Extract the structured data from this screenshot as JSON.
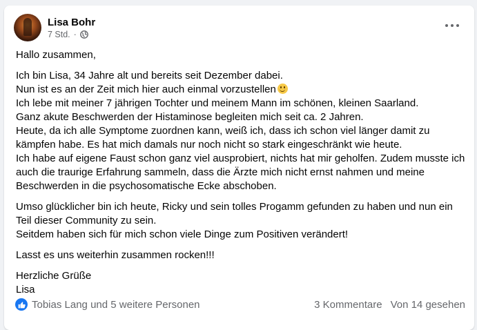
{
  "post": {
    "author": "Lisa Bohr",
    "time": "7 Std.",
    "separator": "·",
    "body": [
      [
        "Hallo zusammen,"
      ],
      [
        "Ich bin Lisa, 34 Jahre alt und bereits seit Dezember dabei.",
        "Nun ist es an der Zeit mich hier auch einmal vorzustellen",
        "Ich lebe mit meiner 7 jährigen Tochter und meinem Mann im schönen, kleinen Saarland.",
        "Ganz akute Beschwerden der Histaminose begleiten mich seit ca. 2 Jahren.",
        "Heute, da ich alle Symptome zuordnen kann, weiß ich, dass ich schon viel länger damit zu",
        "kämpfen habe. Es hat mich damals nur noch nicht so stark eingeschränkt wie heute.",
        "Ich habe auf eigene Faust schon ganz viel ausprobiert, nichts hat mir geholfen. Zudem musste ich",
        "auch die traurige Erfahrung sammeln, dass die Ärzte mich nicht ernst nahmen und meine",
        "Beschwerden in die psychosomatische Ecke abschoben."
      ],
      [
        "Umso glücklicher bin ich heute, Ricky und sein tolles Progamm gefunden zu haben und nun ein",
        "Teil dieser Community zu sein.",
        "Seitdem haben sich für mich schon viele Dinge zum Positiven verändert!"
      ],
      [
        "Lasst es uns weiterhin zusammen rocken!!!"
      ],
      [
        "Herzliche Grüße",
        "Lisa"
      ]
    ]
  },
  "footer": {
    "likers": "Tobias Lang und 5 weitere Personen",
    "comments": "3 Kommentare",
    "views": "Von 14 gesehen"
  },
  "colors": {
    "background": "#f0f2f5",
    "card": "#ffffff",
    "accent": "#1877f2",
    "secondary_text": "#65676b"
  },
  "icons": {
    "more": "more-horizontal-icon",
    "audience": "globe-icon",
    "emoji": "smiley-icon",
    "reaction": "like-icon"
  }
}
